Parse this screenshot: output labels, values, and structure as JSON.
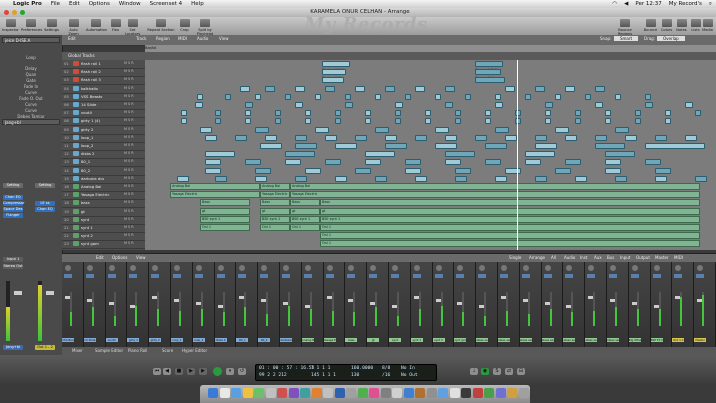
{
  "menubar": {
    "apple": "",
    "app": "Logic Pro",
    "items": [
      "File",
      "Edit",
      "Options",
      "Window",
      "Screenset 4",
      "Help"
    ],
    "clock": "Per 12:37",
    "user": "My Record's"
  },
  "window": {
    "title": "KARAMELA ONUR CELHAN - Arrange"
  },
  "watermark": "My Records",
  "toolbar": {
    "left": [
      "Inspector",
      "Preferences",
      "Settings",
      "Auto Zoom",
      "Automation",
      "Flex",
      "Set Locators",
      "Repeat Section",
      "Crop",
      "Split by Playhead"
    ],
    "right": [
      "Bounce Regions",
      "Bounce",
      "Colors",
      "Notes",
      "Lists",
      "Media"
    ]
  },
  "inspector": {
    "region_header": "jeice D-ISE.A",
    "params": [
      "Loop",
      "Delay",
      "Quan",
      "Gate",
      "Fade In",
      "Curve",
      "Fade O. Out",
      "Curve",
      "Curve",
      "Debes Tamiar"
    ],
    "track_header": "Jang+bl",
    "plugins_left": [
      "Setting",
      "Chan EQ",
      "Compressor",
      "Space Des",
      "Flanger"
    ],
    "plugins_right": [
      "Setting",
      "LE ss",
      "Chan EQ"
    ],
    "io_left": "Input 1",
    "io_left2": "Stereo Out",
    "io_bottom_left": "Jang+bl",
    "io_bottom_right": "Out 1 - 2"
  },
  "arrange": {
    "menu": [
      "Edit",
      "Track",
      "Region",
      "MIDI",
      "Audio",
      "View"
    ],
    "snap_label": "Snap:",
    "snap_value": "Smart",
    "drag_label": "Drag:",
    "drag_value": "Overlap",
    "global": "Global Tracks",
    "ruler_mark": "Bar/bt",
    "tracks": [
      {
        "n": "01",
        "name": "flash roll 1"
      },
      {
        "n": "02",
        "name": "flash roll 2"
      },
      {
        "n": "03",
        "name": "flash roll 3"
      },
      {
        "n": "04",
        "name": "kalkhallo"
      },
      {
        "n": "05",
        "name": "VSS Beasts"
      },
      {
        "n": "06",
        "name": "14 Slide"
      },
      {
        "n": "07",
        "name": "vout4"
      },
      {
        "n": "08",
        "name": "girty 1 (4)"
      },
      {
        "n": "09",
        "name": "girty 2"
      },
      {
        "n": "10",
        "name": "loop_1"
      },
      {
        "n": "11",
        "name": "loop_2"
      },
      {
        "n": "12",
        "name": "dlsbs 2"
      },
      {
        "n": "13",
        "name": "80_1"
      },
      {
        "n": "14",
        "name": "80_2"
      },
      {
        "n": "15",
        "name": "darbuka dcs"
      },
      {
        "n": "16",
        "name": "Analog Bal"
      },
      {
        "n": "17",
        "name": "Yasaga Electric"
      },
      {
        "n": "18",
        "name": "bass"
      },
      {
        "n": "19",
        "name": "gt"
      },
      {
        "n": "20",
        "name": "synt"
      },
      {
        "n": "21",
        "name": "synt 1"
      },
      {
        "n": "22",
        "name": "synt 2"
      },
      {
        "n": "23",
        "name": "synt gam"
      }
    ],
    "audio_labels": [
      "Analog Bal",
      "Analog Bal",
      "Analog Bal",
      "Yasaga Electric",
      "Yasaga Electric",
      "Yasaga Electric",
      "Bass",
      "Bass",
      "Bass",
      "Bass",
      "gt",
      "gt",
      "gt",
      "gt",
      "BSE synt 1",
      "BSE synt 1",
      "BSE synt 1",
      "BSE synt 1",
      "Oni 1",
      "Oni 1",
      "Oni 1",
      "Oni 1",
      "Oni 1"
    ],
    "region_tags": [
      "Flash roll 1 fk",
      "Flash roll 1 fk",
      "Flash roll 1",
      "Flash roll 1"
    ]
  },
  "mixer": {
    "menu": [
      "Edit",
      "Options",
      "View"
    ],
    "filters": [
      "Single",
      "Arrange",
      "All",
      "Audio",
      "Inst",
      "Aux",
      "Bus",
      "Input",
      "Output",
      "Master",
      "MIDI"
    ],
    "strips": [
      "VSS Beas",
      "14 Slide",
      "vout4",
      "girty 1",
      "girty 2",
      "loop_1",
      "loop_2",
      "dlsbs 2",
      "80_1",
      "80_2",
      "darbuka",
      "Analog Ba",
      "Yasaga El",
      "bass",
      "gt",
      "synt",
      "synt 1",
      "synt 2",
      "synt gam",
      "atsas sent",
      "atsas sent",
      "atsas sent",
      "atsas sent",
      "atsas sent",
      "atsas sent",
      "atsas sent",
      "Big Oflas",
      "BSE FX fav",
      "Out 1-2",
      "Master"
    ],
    "bottom_tabs": [
      "Mixer",
      "Sample Editor",
      "Piano Roll",
      "Score",
      "Hyper Editor"
    ]
  },
  "transport": {
    "time": "01 : 00 : 57 : 16.55",
    "bars": "99  2  2  212",
    "beat": "7  1  1  1",
    "beat2": "145  1  1  1",
    "tempo": "160.0000",
    "tempo2": "130",
    "sig": "8/8",
    "div": "/16",
    "in": "No In",
    "out": "No Out"
  }
}
